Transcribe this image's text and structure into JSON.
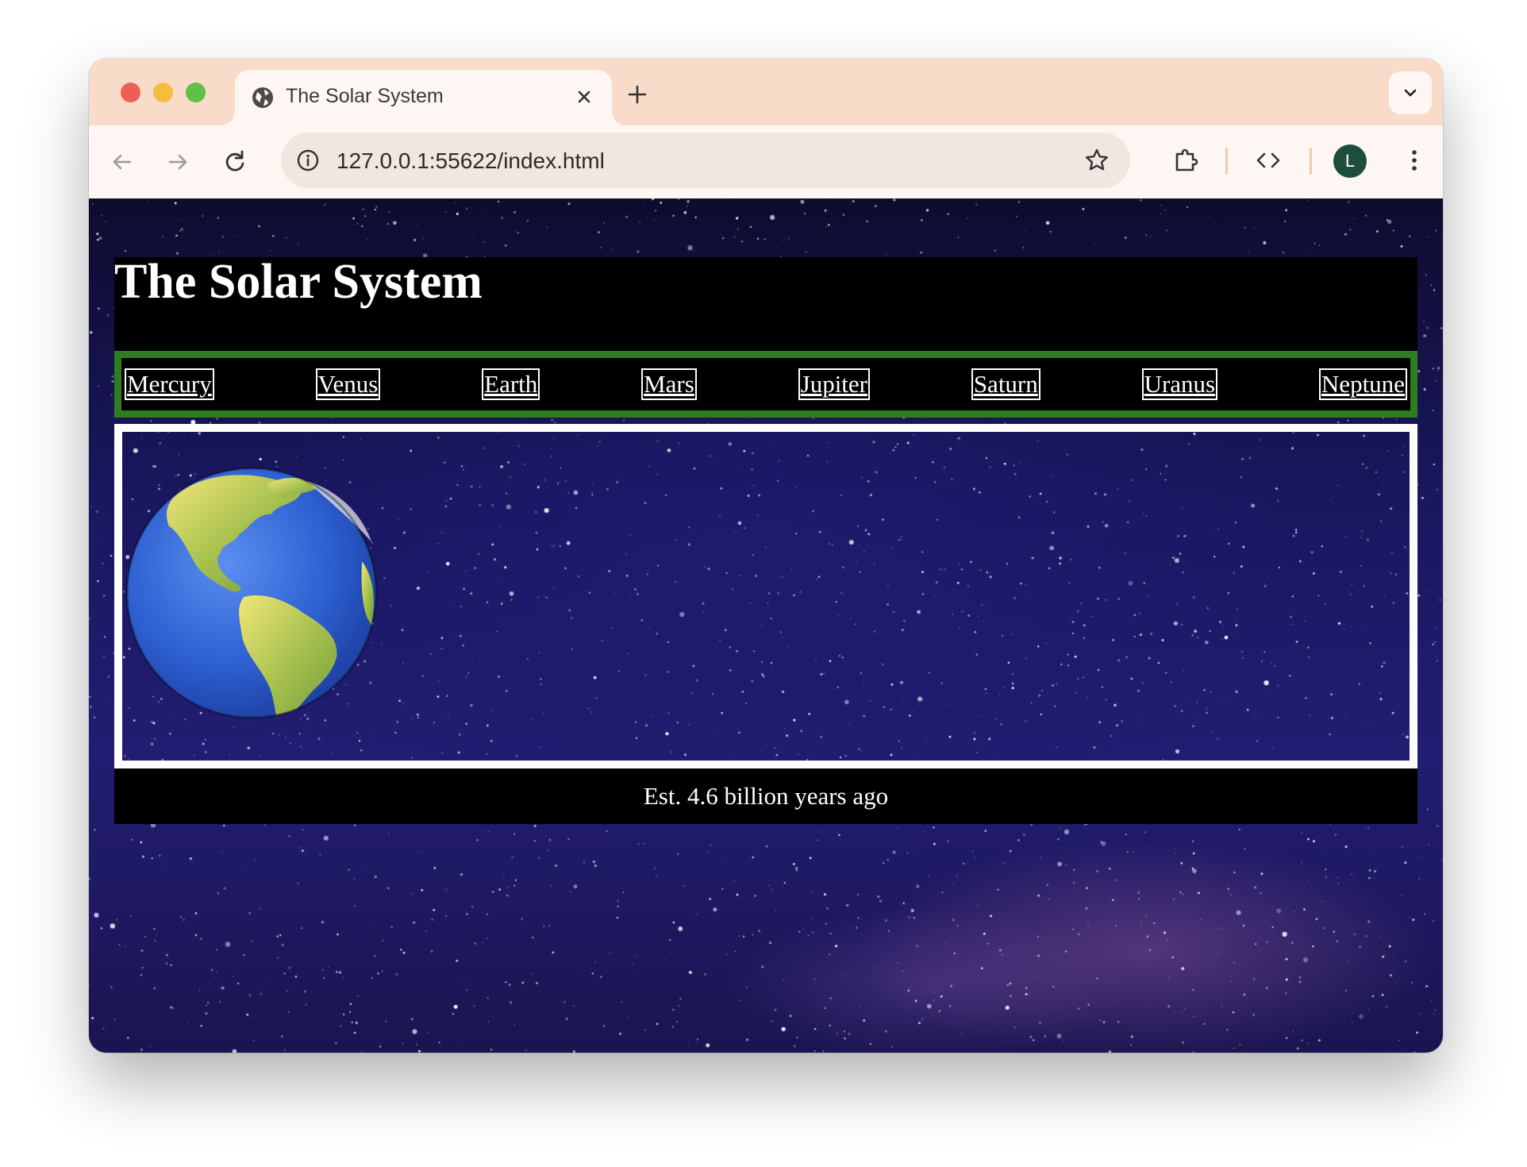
{
  "browser": {
    "tab_title": "The Solar System",
    "url": "127.0.0.1:55622/index.html",
    "profile_initial": "L",
    "accent_color": "#f8dbc9"
  },
  "page": {
    "title": "The Solar System",
    "nav": [
      {
        "label": "Mercury"
      },
      {
        "label": "Venus"
      },
      {
        "label": "Earth"
      },
      {
        "label": "Mars"
      },
      {
        "label": "Jupiter"
      },
      {
        "label": "Saturn"
      },
      {
        "label": "Uranus"
      },
      {
        "label": "Neptune"
      }
    ],
    "nav_border_color": "#2f7d21",
    "featured_image": "earth-globe-americas",
    "footer": "Est. 4.6 billion years ago"
  }
}
